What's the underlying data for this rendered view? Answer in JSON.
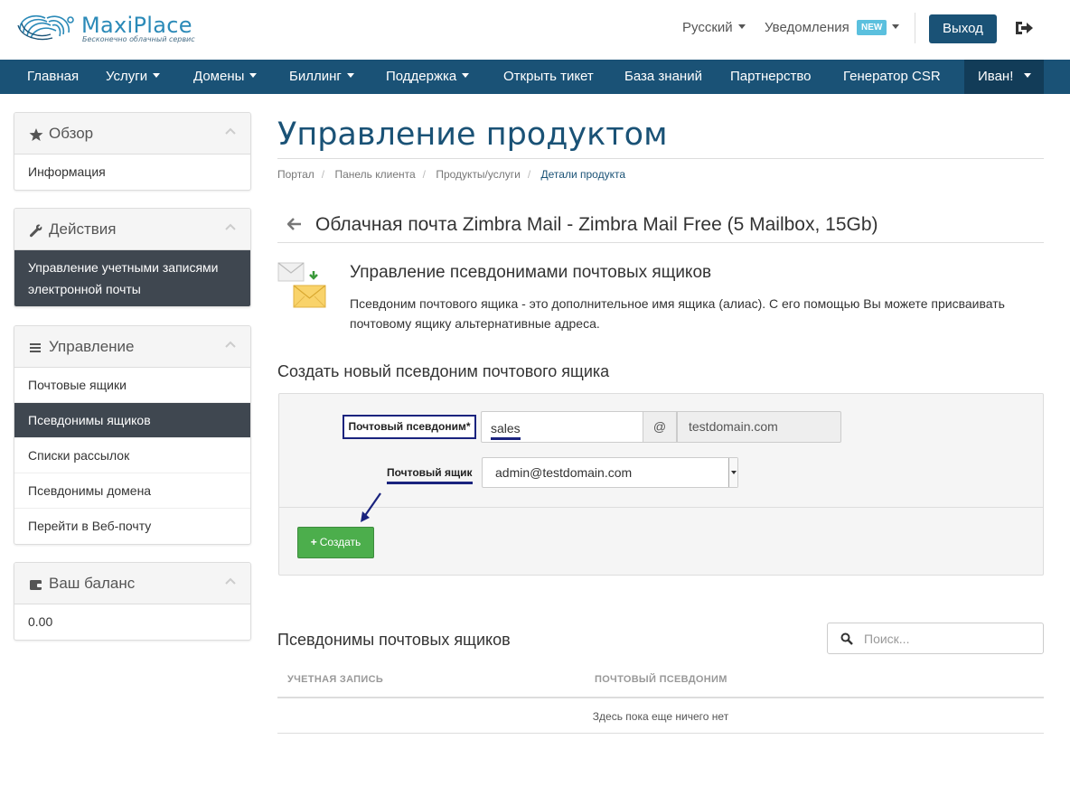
{
  "header": {
    "logo_title": "MaxiPlace",
    "logo_subtitle": "Бесконечно облачный сервис",
    "language": "Русский",
    "notifications": "Уведомления",
    "notifications_badge": "NEW",
    "logout": "Выход"
  },
  "nav": {
    "items": [
      "Главная",
      "Услуги",
      "Домены",
      "Биллинг",
      "Поддержка",
      "Открыть тикет",
      "База знаний",
      "Партнерство",
      "Генератор CSR"
    ],
    "user": "Иван!"
  },
  "sidebar": {
    "overview": {
      "title": "Обзор",
      "items": [
        "Информация"
      ]
    },
    "actions": {
      "title": "Действия",
      "items": [
        "Управление учетными записями электронной почты"
      ]
    },
    "manage": {
      "title": "Управление",
      "items": [
        "Почтовые ящики",
        "Псевдонимы ящиков",
        "Списки рассылок",
        "Псевдонимы домена",
        "Перейти в Веб-почту"
      ]
    },
    "balance": {
      "title": "Ваш баланс",
      "value": "0.00"
    }
  },
  "main": {
    "title": "Управление продуктом",
    "breadcrumb": [
      "Портал",
      "Панель клиента",
      "Продукты/услуги",
      "Детали продукта"
    ],
    "product_title": "Облачная почта Zimbra Mail - Zimbra Mail Free (5 Mailbox, 15Gb)",
    "alias_heading": "Управление псевдонимами почтовых ящиков",
    "alias_desc": "Псевдоним почтового ящика - это дополнительное имя ящика (алиас). С его помощью Вы можете присваивать почтовому ящику альтернативные адреса.",
    "create_heading": "Создать новый псевдоним почтового ящика",
    "form": {
      "alias_label": "Почтовый псевдоним*",
      "alias_value": "sales",
      "at": "@",
      "domain": "testdomain.com",
      "mailbox_label": "Почтовый ящик",
      "mailbox_value": "admin@testdomain.com",
      "create_button": "Создать"
    },
    "list_heading": "Псевдонимы почтовых ящиков",
    "search_placeholder": "Поиск...",
    "table": {
      "columns": [
        "УЧЕТНАЯ ЗАПИСЬ",
        "ПОЧТОВЫЙ ПСЕВДОНИМ"
      ],
      "empty": "Здесь пока еще ничего нет"
    }
  },
  "colors": {
    "brand": "#1a5276",
    "success": "#4cae4c",
    "badge": "#5bc0de",
    "sidebar_active": "#3f4750"
  }
}
